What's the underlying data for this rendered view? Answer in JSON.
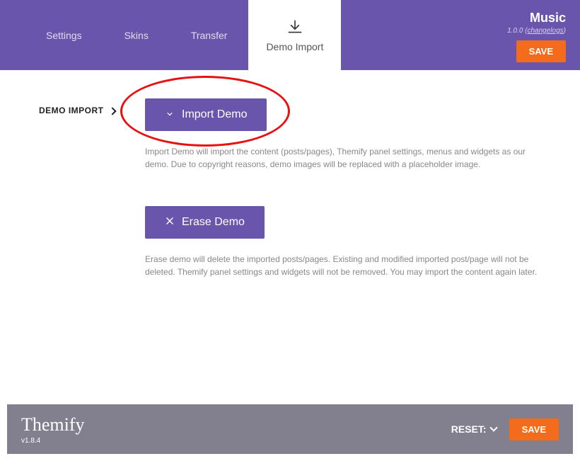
{
  "header": {
    "tabs": [
      {
        "label": "Settings"
      },
      {
        "label": "Skins"
      },
      {
        "label": "Transfer"
      },
      {
        "label": "Demo Import"
      }
    ],
    "theme_title": "Music",
    "version": "1.0.0",
    "changelogs_label": "changelogs",
    "save_label": "SAVE"
  },
  "section": {
    "title": "DEMO IMPORT",
    "import_button": "Import Demo",
    "import_desc": "Import Demo will import the content (posts/pages), Themify panel settings, menus and widgets as our demo. Due to copyright reasons, demo images will be replaced with a placeholder image.",
    "erase_button": "Erase Demo",
    "erase_desc": "Erase demo will delete the imported posts/pages. Existing and modified imported post/page will not be deleted. Themify panel settings and widgets will not be removed. You may import the content again later."
  },
  "footer": {
    "brand": "Themify",
    "version": "v1.8.4",
    "reset_label": "RESET:",
    "save_label": "SAVE"
  }
}
